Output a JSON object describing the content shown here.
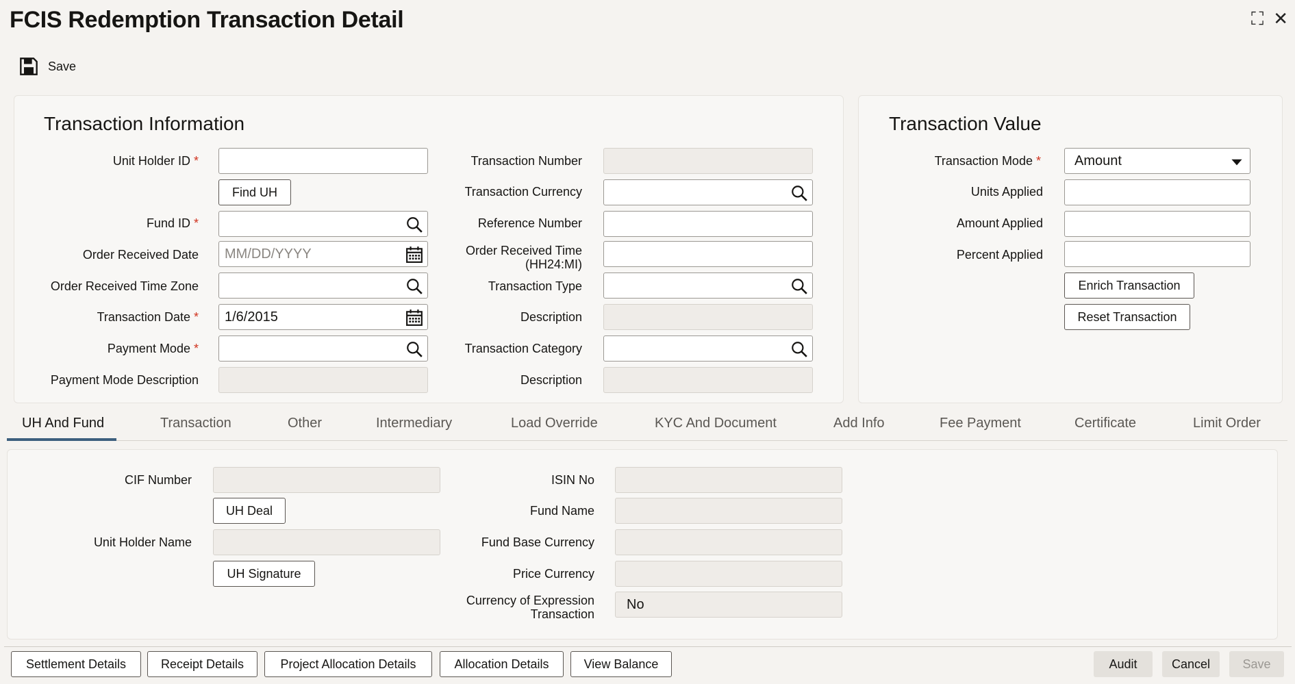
{
  "window": {
    "title": "FCIS Redemption Transaction Detail",
    "maximize_symbol": "⛶",
    "close_symbol": "✕"
  },
  "toolbar": {
    "save_label": "Save",
    "save_icon": "floppy-disk-icon"
  },
  "transaction_information": {
    "title": "Transaction Information",
    "unit_holder_id": {
      "label": "Unit Holder ID",
      "required": "*",
      "value": ""
    },
    "find_uh_button": "Find UH",
    "fund_id": {
      "label": "Fund ID",
      "required": "*",
      "value": ""
    },
    "order_received_date": {
      "label": "Order Received Date",
      "placeholder": "MM/DD/YYYY",
      "value": ""
    },
    "order_received_time_zone": {
      "label": "Order Received Time Zone",
      "value": ""
    },
    "transaction_date": {
      "label": "Transaction Date",
      "required": "*",
      "value": "1/6/2015"
    },
    "payment_mode": {
      "label": "Payment Mode",
      "required": "*",
      "value": ""
    },
    "payment_mode_description": {
      "label": "Payment Mode Description",
      "value": ""
    },
    "transaction_number": {
      "label": "Transaction Number",
      "value": ""
    },
    "transaction_currency": {
      "label": "Transaction Currency",
      "value": ""
    },
    "reference_number": {
      "label": "Reference Number",
      "value": ""
    },
    "order_received_time": {
      "label_line1": "Order Received Time",
      "label_line2": "(HH24:MI)",
      "value": ""
    },
    "transaction_type": {
      "label": "Transaction Type",
      "value": ""
    },
    "description_1": {
      "label": "Description",
      "value": ""
    },
    "transaction_category": {
      "label": "Transaction Category",
      "value": ""
    },
    "description_2": {
      "label": "Description",
      "value": ""
    }
  },
  "transaction_value": {
    "title": "Transaction Value",
    "transaction_mode": {
      "label": "Transaction Mode",
      "required": "*",
      "value": "Amount"
    },
    "units_applied": {
      "label": "Units Applied",
      "value": ""
    },
    "amount_applied": {
      "label": "Amount Applied",
      "value": ""
    },
    "percent_applied": {
      "label": "Percent Applied",
      "value": ""
    },
    "enrich_button": "Enrich Transaction",
    "reset_button": "Reset Transaction"
  },
  "tabs": [
    {
      "label": "UH And Fund",
      "active": true
    },
    {
      "label": "Transaction"
    },
    {
      "label": "Other"
    },
    {
      "label": "Intermediary"
    },
    {
      "label": "Load Override"
    },
    {
      "label": "KYC And Document"
    },
    {
      "label": "Add Info"
    },
    {
      "label": "Fee Payment"
    },
    {
      "label": "Certificate"
    },
    {
      "label": "Limit Order"
    }
  ],
  "uh_and_fund": {
    "cif_number": {
      "label": "CIF Number",
      "value": ""
    },
    "uh_deal_button": "UH Deal",
    "unit_holder_name": {
      "label": "Unit Holder Name",
      "value": ""
    },
    "uh_signature_button": "UH Signature",
    "isin_no": {
      "label": "ISIN No",
      "value": ""
    },
    "fund_name": {
      "label": "Fund Name",
      "value": ""
    },
    "fund_base_currency": {
      "label": "Fund Base Currency",
      "value": ""
    },
    "price_currency": {
      "label": "Price Currency",
      "value": ""
    },
    "currency_of_expression": {
      "label_line1": "Currency of Expression",
      "label_line2": "Transaction",
      "value": "No"
    }
  },
  "footer": {
    "settlement_details": "Settlement Details",
    "receipt_details": "Receipt Details",
    "project_allocation_details": "Project Allocation Details",
    "allocation_details": "Allocation Details",
    "view_balance": "View Balance",
    "audit": "Audit",
    "cancel": "Cancel",
    "save": "Save"
  },
  "colors": {
    "required": "#d0331f",
    "tab_underline": "#3d5f7e",
    "background": "#f5f3f0"
  }
}
